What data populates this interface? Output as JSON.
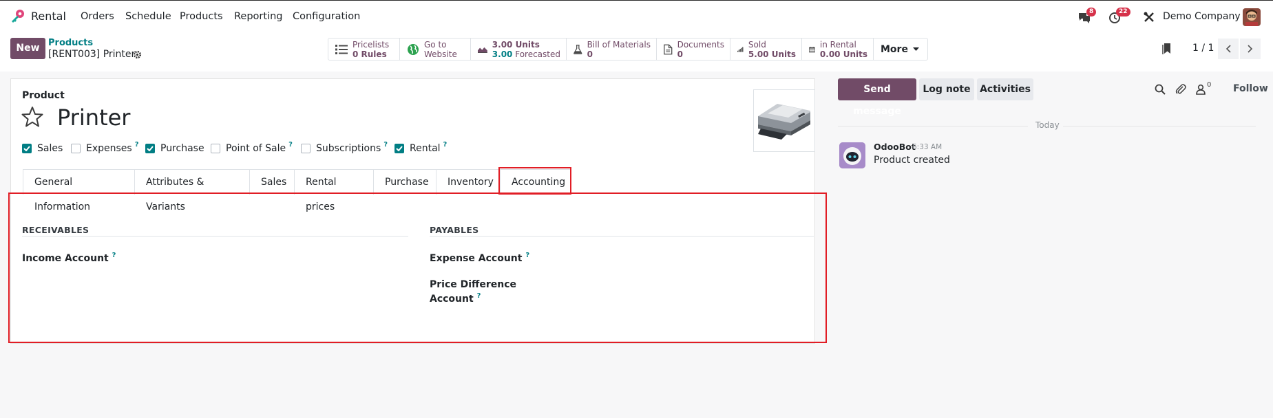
{
  "navbar": {
    "app_name": "Rental",
    "menu": [
      "Orders",
      "Schedule",
      "Products",
      "Reporting",
      "Configuration"
    ],
    "messages_badge": "8",
    "activities_badge": "22",
    "company": "Demo Company"
  },
  "control_panel": {
    "new_label": "New",
    "breadcrumb_parent": "Products",
    "breadcrumb_current": "[RENT003] Printer",
    "stats": [
      {
        "icon": "list-icon",
        "line1": "Pricelists",
        "line2": "0 Rules"
      },
      {
        "icon": "globe-icon",
        "line1": "Go to",
        "line2": "Website"
      },
      {
        "icon": "area-chart-icon",
        "line1": "3.00 Units",
        "line2_value": "3.00",
        "line2_label": "Forecasted"
      },
      {
        "icon": "flask-icon",
        "line1": "Bill of Materials",
        "line2": "0"
      },
      {
        "icon": "document-icon",
        "line1": "Documents",
        "line2": "0"
      },
      {
        "icon": "signal-bars-icon",
        "line1": "Sold",
        "line2": "5.00 Units"
      },
      {
        "icon": "calendar-icon",
        "line1": "in Rental",
        "line2": "0.00 Units"
      }
    ],
    "more_label": "More",
    "pager": "1 / 1"
  },
  "form": {
    "record_type": "Product",
    "name": "Printer",
    "checkboxes": [
      {
        "label": "Sales",
        "checked": true,
        "help": false
      },
      {
        "label": "Expenses",
        "checked": false,
        "help": true
      },
      {
        "label": "Purchase",
        "checked": true,
        "help": false
      },
      {
        "label": "Point of Sale",
        "checked": false,
        "help": true
      },
      {
        "label": "Subscriptions",
        "checked": false,
        "help": true
      },
      {
        "label": "Rental",
        "checked": true,
        "help": true
      }
    ],
    "tabs": [
      "General Information",
      "Attributes & Variants",
      "Sales",
      "Rental prices",
      "Purchase",
      "Inventory",
      "Accounting"
    ],
    "active_tab": "Accounting",
    "receivables_title": "RECEIVABLES",
    "payables_title": "PAYABLES",
    "income_account_label": "Income Account",
    "expense_account_label": "Expense Account",
    "price_diff_line1": "Price Difference",
    "price_diff_line2": "Account",
    "help_mark": "?"
  },
  "chatter": {
    "send_message": "Send message",
    "log_note": "Log note",
    "activities": "Activities",
    "followers_count": "0",
    "follow": "Follow",
    "date_separator": "Today",
    "message": {
      "author": "OdooBot",
      "time": "6:33 AM",
      "body": "Product created"
    }
  },
  "colors": {
    "brand": "#714b67",
    "teal": "#017e84",
    "badge": "#d6324a",
    "highlight": "#e11d25"
  }
}
